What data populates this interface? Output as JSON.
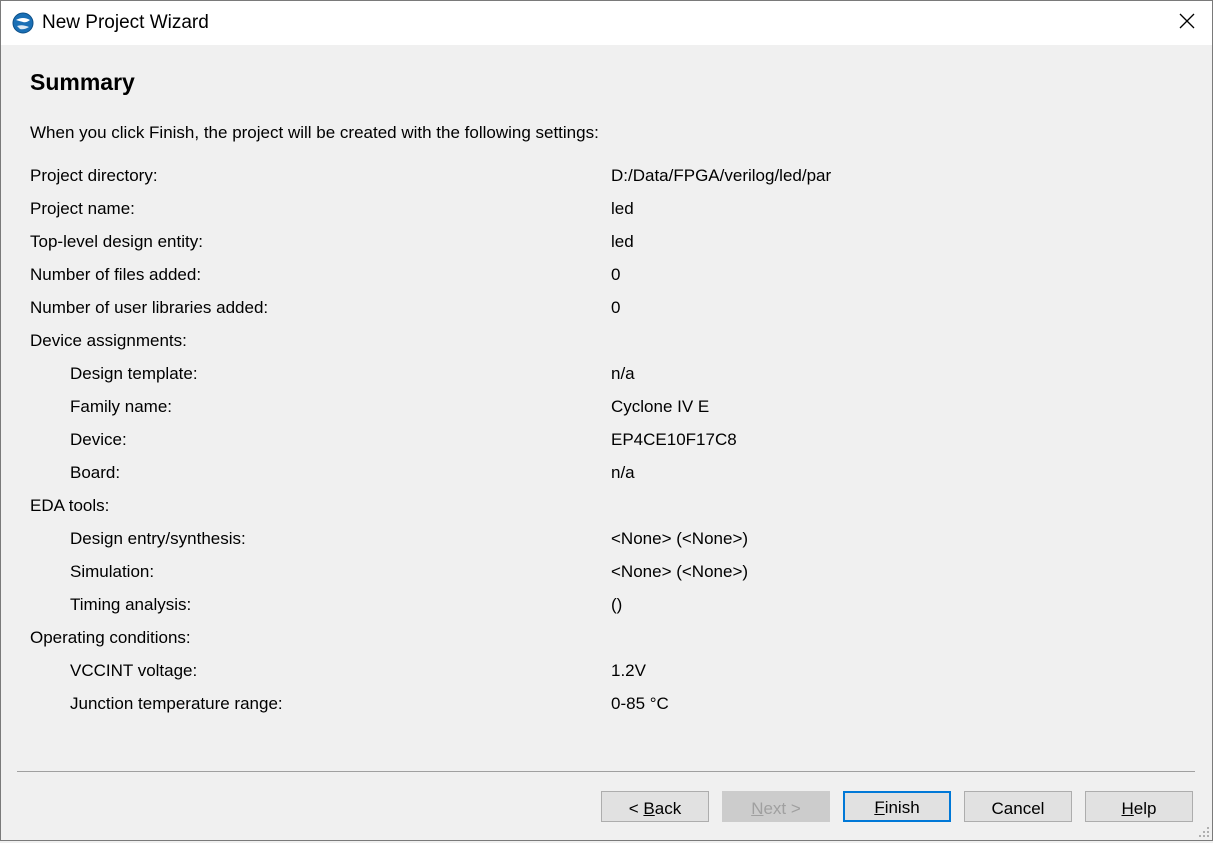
{
  "window": {
    "title": "New Project Wizard"
  },
  "summary": {
    "heading": "Summary",
    "intro": "When you click Finish, the project will be created with the following settings:",
    "rows": [
      {
        "label": "Project directory:",
        "value": "D:/Data/FPGA/verilog/led/par",
        "indent": false
      },
      {
        "label": "Project name:",
        "value": "led",
        "indent": false
      },
      {
        "label": "Top-level design entity:",
        "value": "led",
        "indent": false
      },
      {
        "label": "Number of files added:",
        "value": "0",
        "indent": false
      },
      {
        "label": "Number of user libraries added:",
        "value": "0",
        "indent": false
      },
      {
        "label": "Device assignments:",
        "value": "",
        "indent": false
      },
      {
        "label": "Design template:",
        "value": "n/a",
        "indent": true
      },
      {
        "label": "Family name:",
        "value": "Cyclone IV E",
        "indent": true
      },
      {
        "label": "Device:",
        "value": "EP4CE10F17C8",
        "indent": true
      },
      {
        "label": "Board:",
        "value": "n/a",
        "indent": true
      },
      {
        "label": "EDA tools:",
        "value": "",
        "indent": false
      },
      {
        "label": "Design entry/synthesis:",
        "value": "<None> (<None>)",
        "indent": true
      },
      {
        "label": "Simulation:",
        "value": "<None> (<None>)",
        "indent": true
      },
      {
        "label": "Timing analysis:",
        "value": " ()",
        "indent": true
      },
      {
        "label": "Operating conditions:",
        "value": "",
        "indent": false
      },
      {
        "label": "VCCINT voltage:",
        "value": "1.2V",
        "indent": true
      },
      {
        "label": "Junction temperature range:",
        "value": "0-85 °C",
        "indent": true
      }
    ]
  },
  "buttons": {
    "back": {
      "prefix": "< ",
      "mnemonic": "B",
      "rest": "ack",
      "enabled": true
    },
    "next": {
      "prefix": "",
      "mnemonic": "N",
      "rest": "ext >",
      "enabled": false
    },
    "finish": {
      "prefix": "",
      "mnemonic": "F",
      "rest": "inish",
      "enabled": true
    },
    "cancel": {
      "label": "Cancel",
      "enabled": true
    },
    "help": {
      "prefix": "",
      "mnemonic": "H",
      "rest": "elp",
      "enabled": true
    }
  },
  "icons": {
    "app": "quartus-globe-icon",
    "close": "close-icon",
    "resize": "resize-grip-icon"
  },
  "colors": {
    "accent": "#0078d7",
    "background": "#f0f0f0",
    "titlebar": "#ffffff"
  }
}
